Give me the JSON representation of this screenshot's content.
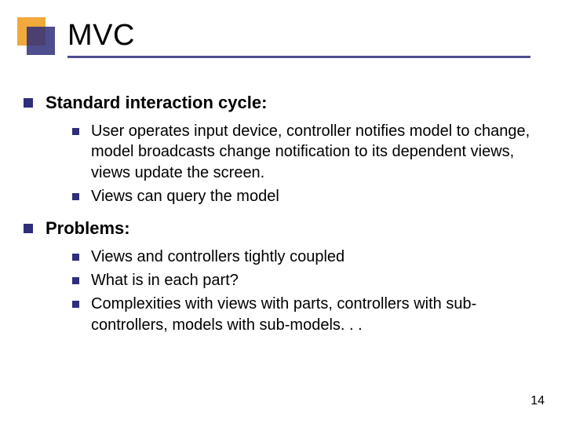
{
  "title": "MVC",
  "sections": [
    {
      "heading": "Standard interaction cycle:",
      "items": [
        "User operates input device, controller notifies model to change, model broadcasts change notification to its dependent views, views update the screen.",
        "Views can query the model"
      ]
    },
    {
      "heading": "Problems:",
      "items": [
        "Views and controllers tightly coupled",
        "What is in each part?",
        "Complexities with views with parts, controllers with sub-controllers, models with sub-models. . ."
      ]
    }
  ],
  "page_number": "14",
  "colors": {
    "accent_navy": "#2f2e7a",
    "accent_orange": "#f0a93a"
  }
}
